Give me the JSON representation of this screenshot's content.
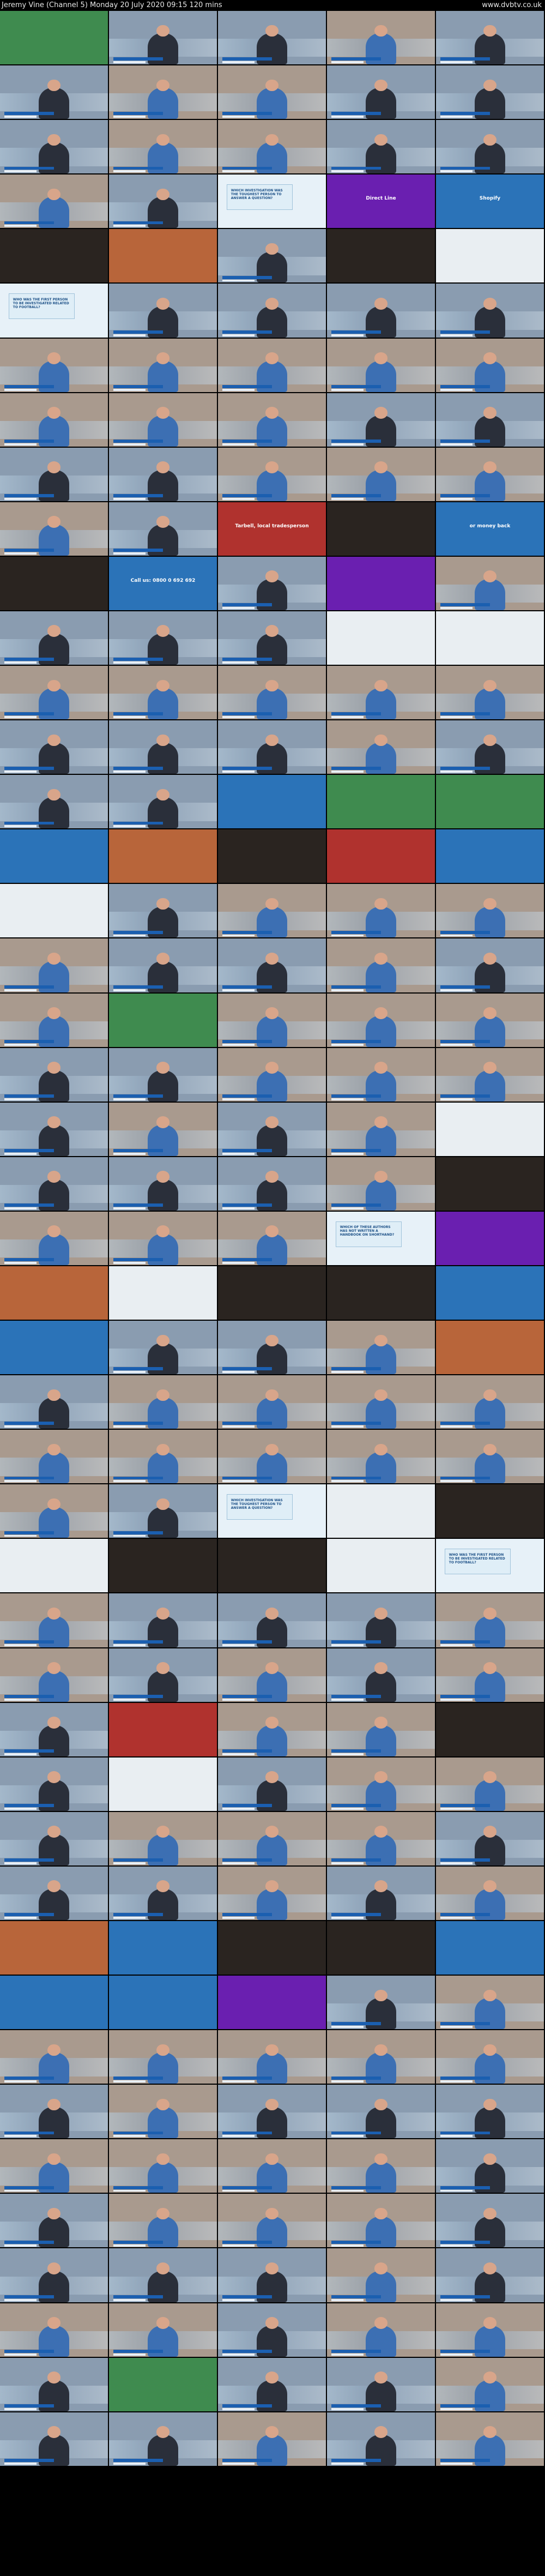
{
  "header": {
    "title": "Jeremy Vine  (Channel 5)   Monday 20 July 2020  09:15  120 mins",
    "site": "www.dvbtv.co.uk"
  },
  "grid": {
    "columns": 5,
    "rows": 47,
    "tiles": [
      {
        "s": "ad-green"
      },
      {
        "s": "studio-man"
      },
      {
        "s": "studio-man"
      },
      {
        "s": "studio-woman"
      },
      {
        "s": "studio-man"
      },
      {
        "s": "studio-man"
      },
      {
        "s": "studio-woman"
      },
      {
        "s": "studio-woman"
      },
      {
        "s": "studio-man"
      },
      {
        "s": "studio-man"
      },
      {
        "s": "studio-man"
      },
      {
        "s": "studio-woman"
      },
      {
        "s": "studio-woman"
      },
      {
        "s": "studio-man"
      },
      {
        "s": "studio-man"
      },
      {
        "s": "studio-woman"
      },
      {
        "s": "studio-man"
      },
      {
        "s": "panel"
      },
      {
        "s": "ad-purple"
      },
      {
        "s": "ad-blue"
      },
      {
        "s": "ad-dark"
      },
      {
        "s": "ad-warm"
      },
      {
        "s": "studio-man"
      },
      {
        "s": "ad-dark"
      },
      {
        "s": "ad-light"
      },
      {
        "s": "panel"
      },
      {
        "s": "studio-man"
      },
      {
        "s": "studio-man"
      },
      {
        "s": "studio-man"
      },
      {
        "s": "studio-man"
      },
      {
        "s": "studio-woman"
      },
      {
        "s": "studio-woman"
      },
      {
        "s": "studio-woman"
      },
      {
        "s": "studio-woman"
      },
      {
        "s": "studio-woman"
      },
      {
        "s": "studio-woman"
      },
      {
        "s": "studio-woman"
      },
      {
        "s": "studio-woman"
      },
      {
        "s": "studio-man"
      },
      {
        "s": "studio-man"
      },
      {
        "s": "studio-man"
      },
      {
        "s": "studio-man"
      },
      {
        "s": "studio-woman"
      },
      {
        "s": "studio-woman"
      },
      {
        "s": "studio-woman"
      },
      {
        "s": "studio-woman"
      },
      {
        "s": "studio-man"
      },
      {
        "s": "ad-red"
      },
      {
        "s": "ad-dark"
      },
      {
        "s": "ad-blue"
      },
      {
        "s": "ad-dark"
      },
      {
        "s": "ad-blue"
      },
      {
        "s": "studio-man"
      },
      {
        "s": "ad-purple"
      },
      {
        "s": "studio-woman"
      },
      {
        "s": "studio-man"
      },
      {
        "s": "studio-man"
      },
      {
        "s": "studio-man"
      },
      {
        "s": "ad-light"
      },
      {
        "s": "ad-light"
      },
      {
        "s": "studio-woman"
      },
      {
        "s": "studio-woman"
      },
      {
        "s": "studio-woman"
      },
      {
        "s": "studio-woman"
      },
      {
        "s": "studio-woman"
      },
      {
        "s": "studio-man"
      },
      {
        "s": "studio-man"
      },
      {
        "s": "studio-man"
      },
      {
        "s": "studio-woman"
      },
      {
        "s": "studio-man"
      },
      {
        "s": "studio-man"
      },
      {
        "s": "studio-man"
      },
      {
        "s": "ad-blue"
      },
      {
        "s": "ad-green"
      },
      {
        "s": "ad-green"
      },
      {
        "s": "ad-blue"
      },
      {
        "s": "ad-warm"
      },
      {
        "s": "ad-dark"
      },
      {
        "s": "ad-red"
      },
      {
        "s": "ad-blue"
      },
      {
        "s": "ad-light"
      },
      {
        "s": "studio-man"
      },
      {
        "s": "studio-woman"
      },
      {
        "s": "studio-woman"
      },
      {
        "s": "studio-woman"
      },
      {
        "s": "studio-woman"
      },
      {
        "s": "studio-man"
      },
      {
        "s": "studio-man"
      },
      {
        "s": "studio-woman"
      },
      {
        "s": "studio-man"
      },
      {
        "s": "studio-woman"
      },
      {
        "s": "ad-green"
      },
      {
        "s": "studio-woman"
      },
      {
        "s": "studio-woman"
      },
      {
        "s": "studio-woman"
      },
      {
        "s": "studio-man"
      },
      {
        "s": "studio-man"
      },
      {
        "s": "studio-woman"
      },
      {
        "s": "studio-woman"
      },
      {
        "s": "studio-woman"
      },
      {
        "s": "studio-man"
      },
      {
        "s": "studio-woman"
      },
      {
        "s": "studio-man"
      },
      {
        "s": "studio-woman"
      },
      {
        "s": "ad-light"
      },
      {
        "s": "studio-man"
      },
      {
        "s": "studio-man"
      },
      {
        "s": "studio-man"
      },
      {
        "s": "studio-woman"
      },
      {
        "s": "ad-dark"
      },
      {
        "s": "studio-woman"
      },
      {
        "s": "studio-woman"
      },
      {
        "s": "studio-woman"
      },
      {
        "s": "panel"
      },
      {
        "s": "ad-purple"
      },
      {
        "s": "ad-warm"
      },
      {
        "s": "ad-light"
      },
      {
        "s": "ad-dark"
      },
      {
        "s": "ad-dark"
      },
      {
        "s": "ad-blue"
      },
      {
        "s": "ad-blue"
      },
      {
        "s": "studio-man"
      },
      {
        "s": "studio-man"
      },
      {
        "s": "studio-woman"
      },
      {
        "s": "ad-warm"
      },
      {
        "s": "studio-man"
      },
      {
        "s": "studio-woman"
      },
      {
        "s": "studio-woman"
      },
      {
        "s": "studio-woman"
      },
      {
        "s": "studio-woman"
      },
      {
        "s": "studio-woman"
      },
      {
        "s": "studio-woman"
      },
      {
        "s": "studio-woman"
      },
      {
        "s": "studio-woman"
      },
      {
        "s": "studio-woman"
      },
      {
        "s": "studio-woman"
      },
      {
        "s": "studio-man"
      },
      {
        "s": "panel"
      },
      {
        "s": "ad-light"
      },
      {
        "s": "ad-dark"
      },
      {
        "s": "ad-light"
      },
      {
        "s": "ad-dark"
      },
      {
        "s": "ad-dark"
      },
      {
        "s": "ad-light"
      },
      {
        "s": "panel"
      },
      {
        "s": "studio-woman"
      },
      {
        "s": "studio-man"
      },
      {
        "s": "studio-man"
      },
      {
        "s": "studio-man"
      },
      {
        "s": "studio-woman"
      },
      {
        "s": "studio-woman"
      },
      {
        "s": "studio-man"
      },
      {
        "s": "studio-woman"
      },
      {
        "s": "studio-man"
      },
      {
        "s": "studio-woman"
      },
      {
        "s": "studio-man"
      },
      {
        "s": "ad-red"
      },
      {
        "s": "studio-woman"
      },
      {
        "s": "studio-woman"
      },
      {
        "s": "ad-dark"
      },
      {
        "s": "studio-man"
      },
      {
        "s": "ad-light"
      },
      {
        "s": "studio-man"
      },
      {
        "s": "studio-woman"
      },
      {
        "s": "studio-woman"
      },
      {
        "s": "studio-man"
      },
      {
        "s": "studio-woman"
      },
      {
        "s": "studio-woman"
      },
      {
        "s": "studio-woman"
      },
      {
        "s": "studio-man"
      },
      {
        "s": "studio-man"
      },
      {
        "s": "studio-man"
      },
      {
        "s": "studio-woman"
      },
      {
        "s": "studio-man"
      },
      {
        "s": "studio-woman"
      },
      {
        "s": "ad-warm"
      },
      {
        "s": "ad-blue"
      },
      {
        "s": "ad-dark"
      },
      {
        "s": "ad-dark"
      },
      {
        "s": "ad-blue"
      },
      {
        "s": "ad-blue"
      },
      {
        "s": "ad-blue"
      },
      {
        "s": "ad-purple"
      },
      {
        "s": "studio-man"
      },
      {
        "s": "studio-woman"
      },
      {
        "s": "studio-woman"
      },
      {
        "s": "studio-woman"
      },
      {
        "s": "studio-woman"
      },
      {
        "s": "studio-woman"
      },
      {
        "s": "studio-woman"
      },
      {
        "s": "studio-man"
      },
      {
        "s": "studio-woman"
      },
      {
        "s": "studio-man"
      },
      {
        "s": "studio-man"
      },
      {
        "s": "studio-man"
      },
      {
        "s": "studio-woman"
      },
      {
        "s": "studio-woman"
      },
      {
        "s": "studio-woman"
      },
      {
        "s": "studio-woman"
      },
      {
        "s": "studio-man"
      },
      {
        "s": "studio-man"
      },
      {
        "s": "studio-woman"
      },
      {
        "s": "studio-woman"
      },
      {
        "s": "studio-woman"
      },
      {
        "s": "studio-man"
      },
      {
        "s": "studio-man"
      },
      {
        "s": "studio-man"
      },
      {
        "s": "studio-man"
      },
      {
        "s": "studio-woman"
      },
      {
        "s": "studio-man"
      },
      {
        "s": "studio-woman"
      },
      {
        "s": "studio-woman"
      },
      {
        "s": "studio-man"
      },
      {
        "s": "studio-woman"
      },
      {
        "s": "studio-woman"
      },
      {
        "s": "studio-man"
      },
      {
        "s": "ad-green"
      },
      {
        "s": "studio-man"
      },
      {
        "s": "studio-man"
      },
      {
        "s": "studio-woman"
      },
      {
        "s": "studio-man"
      },
      {
        "s": "studio-man"
      },
      {
        "s": "studio-woman"
      },
      {
        "s": "studio-man"
      },
      {
        "s": "studio-woman"
      }
    ]
  },
  "panel_captions": [
    "WHICH INVESTIGATION WAS THE TOUGHEST PERSON TO ANSWER A QUESTION?",
    "WHO WAS THE FIRST PERSON TO BE INVESTIGATED RELATED TO FOOTBALL?",
    "WHICH OF THESE AUTHORS HAS NOT WRITTEN A HANDBOOK ON SHORTHAND?"
  ],
  "advert_texts": [
    "Direct Line",
    "Shopify",
    "Tarbell, local tradesperson",
    "or money back",
    "Call us: 0800 0 692 692"
  ],
  "colors": {
    "studio-man": "#8a9cb0",
    "studio-woman": "#a99a8e",
    "panel": "#e7f1f8",
    "ad-green": "#3f8b4f",
    "ad-blue": "#2b73b8",
    "ad-purple": "#6a1fb0",
    "ad-dark": "#2a2420",
    "ad-light": "#e9eef2",
    "ad-warm": "#b8653a",
    "ad-red": "#b0322e"
  }
}
